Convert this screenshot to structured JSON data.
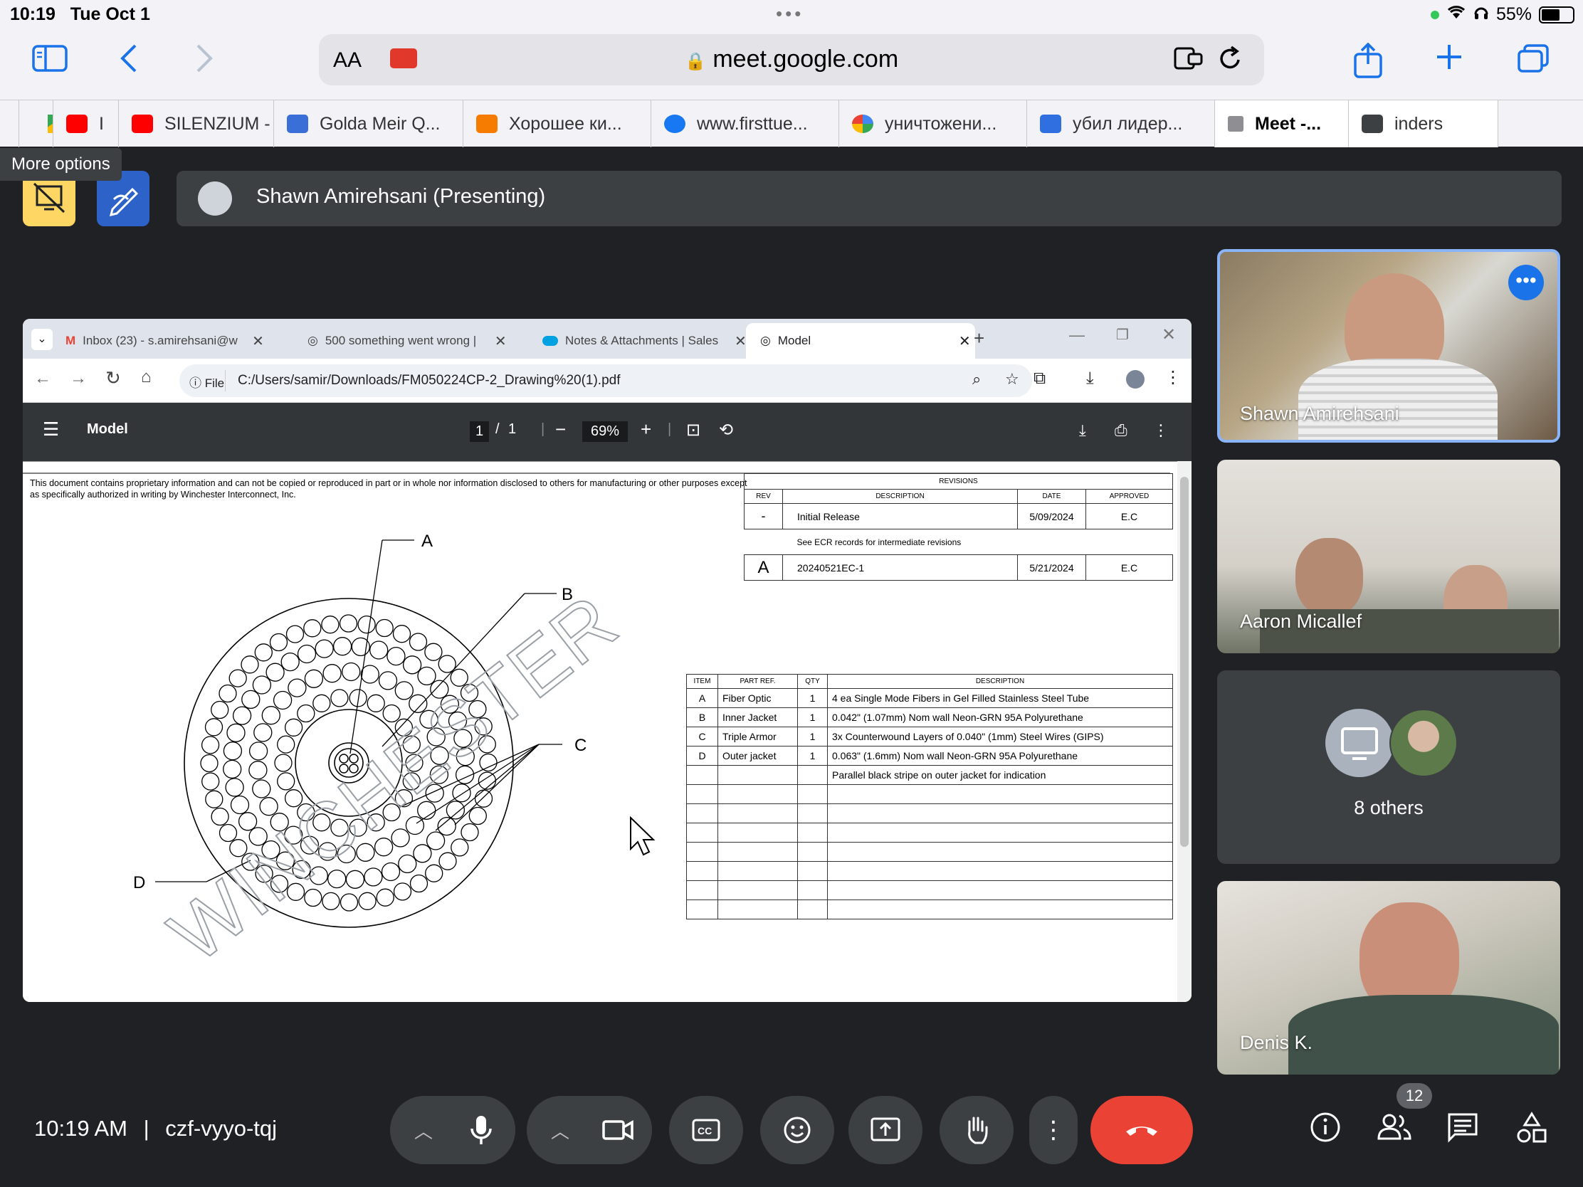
{
  "status": {
    "time": "10:19",
    "date": "Tue Oct 1",
    "battery": "55%"
  },
  "browser": {
    "text_size": "AA",
    "url": "meet.google.com",
    "tabs": [
      {
        "label": "I",
        "fav": "youtube-icon",
        "color": "#ff0000"
      },
      {
        "label": "SILENZIUM -",
        "fav": "youtube-icon",
        "color": "#ff0000"
      },
      {
        "label": "Golda Meir Q...",
        "fav": "book-icon",
        "color": "#3b6fd8"
      },
      {
        "label": "Хорошее ки...",
        "fav": "blogger-icon",
        "color": "#f57c00"
      },
      {
        "label": "www.firsttue...",
        "fav": "facebook-icon",
        "color": "#1877f2"
      },
      {
        "label": "уничтожени...",
        "fav": "google-icon",
        "color": "#4285f4"
      },
      {
        "label": "убил лидер...",
        "fav": "h-icon",
        "color": "#2f6fdf"
      },
      {
        "label": "Meet -...",
        "fav": "close-icon",
        "color": "#999999"
      },
      {
        "label": "inders",
        "fav": "camera-icon",
        "color": "#3c4043"
      }
    ]
  },
  "meet": {
    "tooltip": "More options",
    "presenter_label": "Shawn Amirehsani (Presenting)",
    "participants": [
      {
        "name": "Shawn Amirehsani"
      },
      {
        "name": "Aaron Micallef"
      },
      {
        "name": "8 others"
      },
      {
        "name": "Denis K."
      }
    ],
    "bottom": {
      "time": "10:19 AM",
      "separator": "|",
      "code": "czf-vyyo-tqj",
      "people_count": "12"
    }
  },
  "shared": {
    "tabs": [
      {
        "label": "Inbox (23) - s.amirehsani@w",
        "close": "✕"
      },
      {
        "label": "500 something went wrong |",
        "close": "✕"
      },
      {
        "label": "Notes & Attachments | Sales",
        "close": "✕"
      },
      {
        "label": "Model",
        "close": "✕"
      }
    ],
    "new_tab": "+",
    "file_chip": "File",
    "path": "C:/Users/samir/Downloads/FM050224CP-2_Drawing%20(1).pdf",
    "pdf": {
      "title": "Model",
      "page": "1",
      "page_sep": "/",
      "page_total": "1",
      "zoom": "69%",
      "notice": "This document contains proprietary information and can not be copied or reproduced in part or in whole nor information disclosed to others for manufacturing or other purposes except as specifically authorized in writing by Winchester Interconnect, Inc.",
      "watermark": "WINCHESTER",
      "callouts": {
        "a": "A",
        "b": "B",
        "c": "C",
        "d": "D"
      },
      "revisions": {
        "title": "REVISIONS",
        "headers": [
          "REV",
          "DESCRIPTION",
          "DATE",
          "APPROVED"
        ],
        "rows": [
          {
            "rev": "-",
            "desc": "Initial Release",
            "date": "5/09/2024",
            "appr": "E.C"
          },
          {
            "rev": "A",
            "desc": "20240521EC-1",
            "date": "5/21/2024",
            "appr": "E.C"
          }
        ],
        "note": "See ECR records for intermediate revisions"
      },
      "bom": {
        "headers": [
          "ITEM",
          "PART REF.",
          "QTY",
          "DESCRIPTION"
        ],
        "rows": [
          {
            "item": "A",
            "ref": "Fiber Optic",
            "qty": "1",
            "desc": "4 ea Single Mode Fibers in Gel Filled Stainless Steel Tube"
          },
          {
            "item": "B",
            "ref": "Inner Jacket",
            "qty": "1",
            "desc": "0.042\" (1.07mm) Nom wall Neon-GRN 95A Polyurethane"
          },
          {
            "item": "C",
            "ref": "Triple Armor",
            "qty": "1",
            "desc": "3x Counterwound Layers of 0.040\" (1mm) Steel Wires (GIPS)"
          },
          {
            "item": "D",
            "ref": "Outer jacket",
            "qty": "1",
            "desc": "0.063\" (1.6mm) Nom wall Neon-GRN 95A Polyurethane"
          },
          {
            "item": "",
            "ref": "",
            "qty": "",
            "desc": "Parallel black stripe on outer jacket for indication"
          }
        ]
      }
    }
  }
}
